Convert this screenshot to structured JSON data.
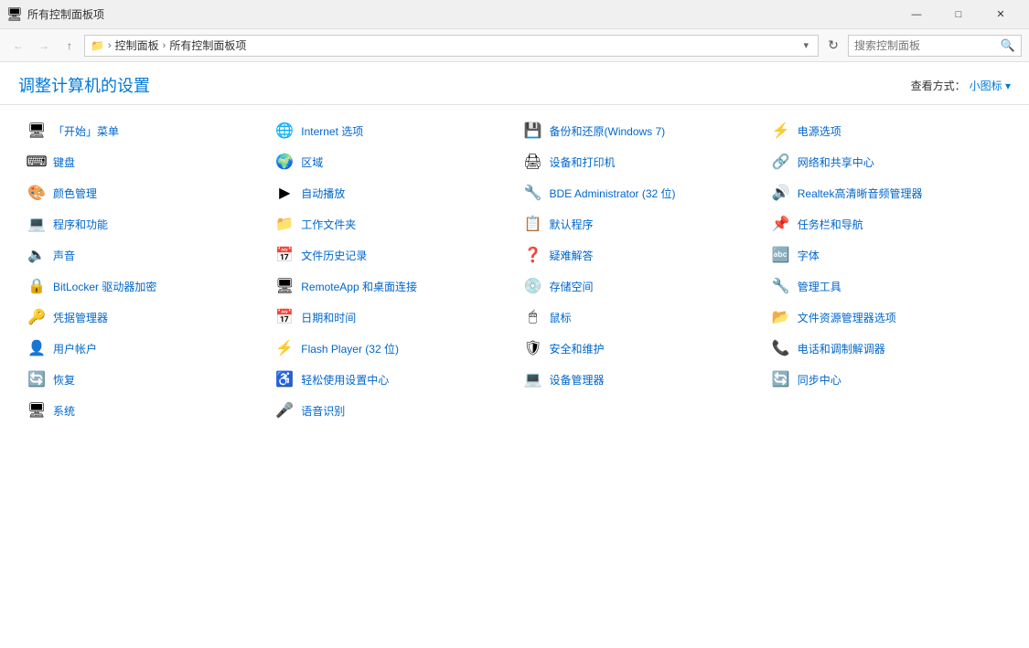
{
  "window": {
    "title": "所有控制面板项",
    "minimize": "—",
    "maximize": "□",
    "close": "✕"
  },
  "navbar": {
    "back_title": "后退",
    "forward_title": "前进",
    "up_title": "上",
    "breadcrumb": [
      "控制面板",
      "所有控制面板项"
    ],
    "refresh_title": "刷新",
    "search_placeholder": "搜索控制面板"
  },
  "content": {
    "title": "调整计算机的设置",
    "view_label": "查看方式：",
    "view_current": "小图标 ▾"
  },
  "items": [
    {
      "icon": "🖥",
      "label": "「开始」菜单"
    },
    {
      "icon": "🌐",
      "label": "Internet 选项"
    },
    {
      "icon": "💾",
      "label": "备份和还原(Windows 7)"
    },
    {
      "icon": "⚡",
      "label": "电源选项"
    },
    {
      "icon": "⌨",
      "label": "键盘"
    },
    {
      "icon": "🌍",
      "label": "区域"
    },
    {
      "icon": "🖨",
      "label": "设备和打印机"
    },
    {
      "icon": "🔗",
      "label": "网络和共享中心"
    },
    {
      "icon": "🎨",
      "label": "颜色管理"
    },
    {
      "icon": "▶",
      "label": "自动播放"
    },
    {
      "icon": "🔧",
      "label": "BDE Administrator (32 位)"
    },
    {
      "icon": "🔊",
      "label": "Realtek高清晰音频管理器"
    },
    {
      "icon": "💻",
      "label": "程序和功能"
    },
    {
      "icon": "📁",
      "label": "工作文件夹"
    },
    {
      "icon": "📋",
      "label": "默认程序"
    },
    {
      "icon": "📌",
      "label": "任务栏和导航"
    },
    {
      "icon": "🔈",
      "label": "声音"
    },
    {
      "icon": "📅",
      "label": "文件历史记录"
    },
    {
      "icon": "❓",
      "label": "疑难解答"
    },
    {
      "icon": "🔤",
      "label": "字体"
    },
    {
      "icon": "🔒",
      "label": "BitLocker 驱动器加密"
    },
    {
      "icon": "🖥",
      "label": "RemoteApp 和桌面连接"
    },
    {
      "icon": "💿",
      "label": "存储空间"
    },
    {
      "icon": "🔧",
      "label": "管理工具"
    },
    {
      "icon": "🔑",
      "label": "凭据管理器"
    },
    {
      "icon": "📅",
      "label": "日期和时间"
    },
    {
      "icon": "🖱",
      "label": "鼠标"
    },
    {
      "icon": "📂",
      "label": "文件资源管理器选项"
    },
    {
      "icon": "👤",
      "label": "用户帐户"
    },
    {
      "icon": "⚡",
      "label": "Flash Player (32 位)"
    },
    {
      "icon": "🛡",
      "label": "安全和维护"
    },
    {
      "icon": "📞",
      "label": "电话和调制解调器"
    },
    {
      "icon": "🔄",
      "label": "恢复"
    },
    {
      "icon": "♿",
      "label": "轻松使用设置中心"
    },
    {
      "icon": "💻",
      "label": "设备管理器"
    },
    {
      "icon": "🔄",
      "label": "同步中心"
    },
    {
      "icon": "🖥",
      "label": "系统"
    },
    {
      "icon": "🎤",
      "label": "语音识别"
    }
  ],
  "colors": {
    "accent": "#0078d7",
    "link": "#0066cc",
    "title_blue": "#0078d7"
  }
}
